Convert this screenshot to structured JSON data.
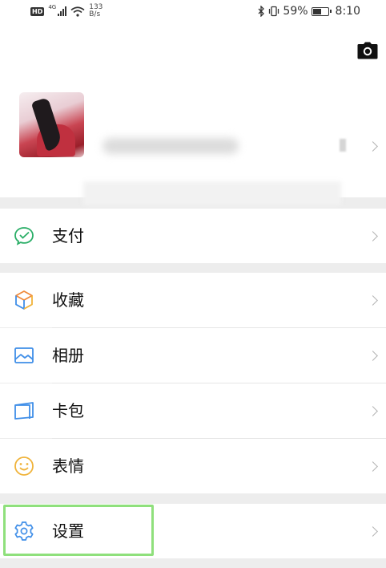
{
  "status_bar": {
    "hd": "HD",
    "network": "4G",
    "speed_value": "133",
    "speed_unit": "B/s",
    "battery_percent": "59%",
    "battery_level": 0.59,
    "time": "8:10"
  },
  "profile": {
    "camera_icon": "camera-icon",
    "avatar_desc": "anime-avatar"
  },
  "menu": {
    "pay": {
      "label": "支付",
      "icon": "wechat-pay-icon",
      "color": "#2aae67"
    },
    "favorites": {
      "label": "收藏",
      "icon": "cube-icon",
      "color": "#f0b33a"
    },
    "album": {
      "label": "相册",
      "icon": "image-icon",
      "color": "#3f8ee8"
    },
    "cards": {
      "label": "卡包",
      "icon": "card-icon",
      "color": "#3f8ee8"
    },
    "stickers": {
      "label": "表情",
      "icon": "smile-icon",
      "color": "#f0b33a"
    },
    "settings": {
      "label": "设置",
      "icon": "gear-icon",
      "color": "#3f8ee8"
    }
  },
  "highlight_color": "#8fe07c"
}
